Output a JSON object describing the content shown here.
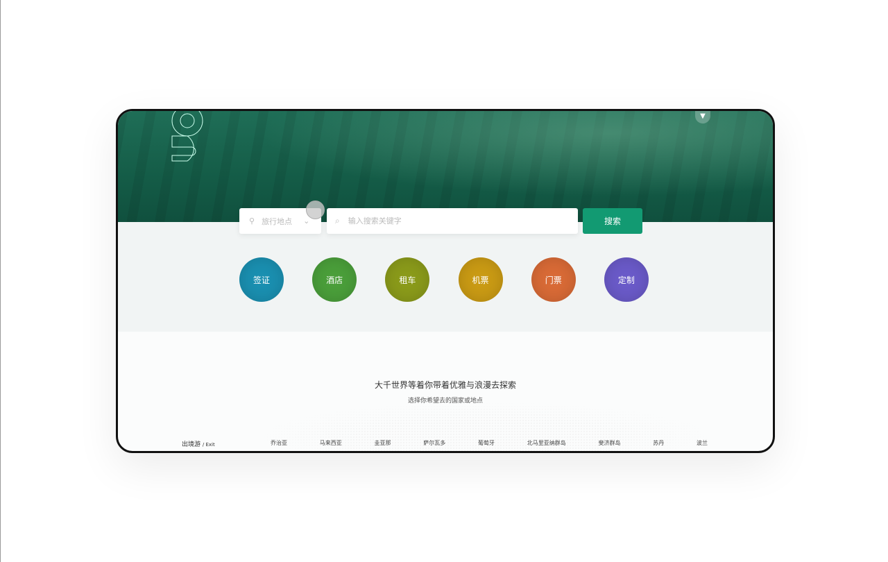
{
  "search": {
    "location_placeholder": "旅行地点",
    "keyword_placeholder": "输入搜索关键字",
    "button": "搜索"
  },
  "categories": [
    {
      "label": "签证",
      "color": "#1a8fb0"
    },
    {
      "label": "酒店",
      "color": "#4a9e3a"
    },
    {
      "label": "租车",
      "color": "#8a9a1a"
    },
    {
      "label": "机票",
      "color": "#c99a14"
    },
    {
      "label": "门票",
      "color": "#d86a36"
    },
    {
      "label": "定制",
      "color": "#6a5ac8"
    }
  ],
  "headline": "大千世界等着你带着优雅与浪漫去探索",
  "subheadline": "选择你希望去的国家或地点",
  "section": {
    "label": "出境游",
    "sub": "/ Exit"
  },
  "countries": [
    "乔治亚",
    "马来西亚",
    "圭亚那",
    "萨尔瓦多",
    "葡萄牙",
    "北马里亚纳群岛",
    "斐济群岛",
    "苏丹",
    "波兰"
  ],
  "colors": {
    "accent": "#129a72",
    "hero": "#145c47"
  }
}
